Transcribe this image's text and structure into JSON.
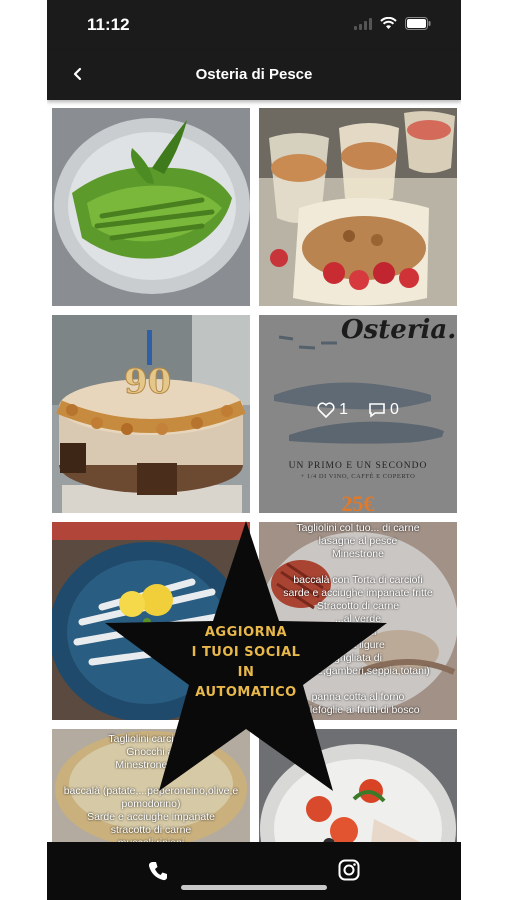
{
  "status": {
    "time": "11:12"
  },
  "header": {
    "title": "Osteria di Pesce",
    "back_icon": "chevron-left-icon"
  },
  "posts": {
    "promo": {
      "likes": "1",
      "comments": "0",
      "brand": "Osteria...",
      "line1": "UN PRIMO E UN SECONDO",
      "line2": "+ 1/4 DI VINO, CAFFÈ E COPERTO",
      "price": "25€"
    },
    "cake": {
      "number": "90"
    },
    "menu_right": {
      "lines": [
        "Tagliolini col tuo... di carne",
        "lasagne al pesce",
        "Minestrone",
        "",
        "baccalà con Torta di carciofi",
        "sarde e acciughe impanate fritte",
        "Stracotto di carne",
        "...al verde",
        "...ripieni",
        "...alla ligure",
        "grigliata di",
        "...pesce,gamberi,seppia,totani)",
        "",
        "panna cotta al forno",
        "millefoglie ai frutti di bosco"
      ]
    },
    "menu_left": {
      "lines": [
        "Tagliolini carciofi e",
        "Gnocchi al",
        "Minestrone alla",
        "",
        "baccalà (patate,...peperoncino,olive,e",
        "pomodorino)",
        "Sarde e acciughe impanate",
        "stracotto di carne",
        "muscoli ripieni"
      ]
    }
  },
  "promo_star": {
    "line1": "AGGIORNA",
    "line2": "I TUOI SOCIAL",
    "line3": "IN",
    "line4": "AUTOMATICO"
  },
  "bottom_bar": {
    "left_icon": "phone-icon",
    "right_icon": "instagram-icon"
  },
  "colors": {
    "bar": "#1b1b1b",
    "bottom_bar": "#0c0c0c",
    "star_text": "#e8b84a"
  }
}
